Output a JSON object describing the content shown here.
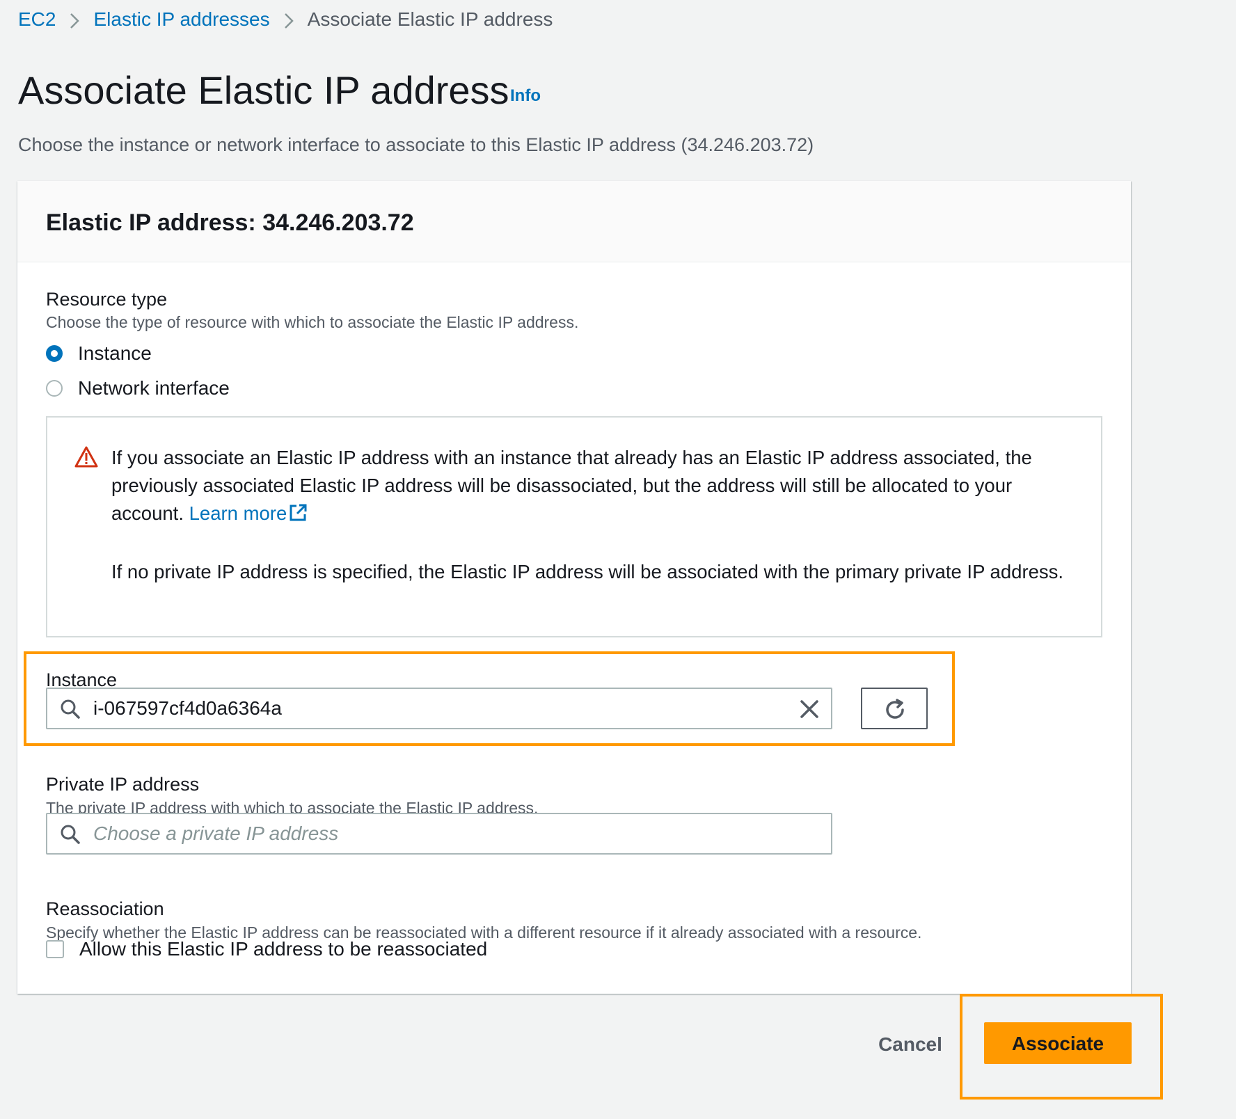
{
  "breadcrumb": {
    "items": [
      {
        "label": "EC2",
        "link": true
      },
      {
        "label": "Elastic IP addresses",
        "link": true
      },
      {
        "label": "Associate Elastic IP address",
        "link": false
      }
    ]
  },
  "page": {
    "title": "Associate Elastic IP address",
    "info_label": "Info",
    "description": "Choose the instance or network interface to associate to this Elastic IP address (34.246.203.72)"
  },
  "panel": {
    "title": "Elastic IP address: 34.246.203.72"
  },
  "resource_type": {
    "label": "Resource type",
    "description": "Choose the type of resource with which to associate the Elastic IP address.",
    "options": [
      {
        "label": "Instance",
        "selected": true
      },
      {
        "label": "Network interface",
        "selected": false
      }
    ]
  },
  "alert": {
    "icon": "warning-icon",
    "text_before_link": "If you associate an Elastic IP address with an instance that already has an Elastic IP address associated, the previously associated Elastic IP address will be disassociated, but the address will still be allocated to your account. ",
    "link_label": "Learn more",
    "second_paragraph": "If no private IP address is specified, the Elastic IP address will be associated with the primary private IP address."
  },
  "instance": {
    "label": "Instance",
    "value": "i-067597cf4d0a6364a",
    "search_icon": "search-icon",
    "clear_icon": "close-icon",
    "refresh_icon": "refresh-icon"
  },
  "private_ip": {
    "label": "Private IP address",
    "description": "The private IP address with which to associate the Elastic IP address.",
    "value": "",
    "placeholder": "Choose a private IP address"
  },
  "reassociation": {
    "label": "Reassociation",
    "description": "Specify whether the Elastic IP address can be reassociated with a different resource if it already associated with a resource.",
    "checkbox_label": "Allow this Elastic IP address to be reassociated",
    "checked": false
  },
  "actions": {
    "cancel_label": "Cancel",
    "associate_label": "Associate"
  },
  "colors": {
    "link": "#0073bb",
    "primary_button": "#ff9900",
    "highlight": "#ff9900",
    "warning": "#d13212"
  }
}
